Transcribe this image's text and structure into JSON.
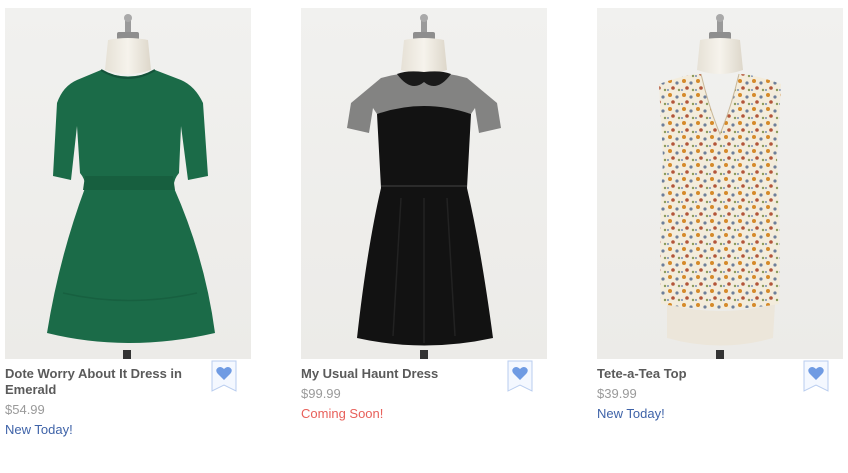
{
  "products": [
    {
      "title": "Dote Worry About It Dress in Emerald",
      "price": "$54.99",
      "badge": "New Today!",
      "badge_type": "new",
      "garment_color": "#1b6b48",
      "image": "emerald-dress-on-mannequin",
      "favorite_icon": "heart-icon"
    },
    {
      "title": "My Usual Haunt Dress",
      "price": "$99.99",
      "badge": "Coming Soon!",
      "badge_type": "soon",
      "garment_color": "#121212",
      "image": "black-velvet-dress-on-mannequin",
      "favorite_icon": "heart-icon"
    },
    {
      "title": "Tete-a-Tea Top",
      "price": "$39.99",
      "badge": "New Today!",
      "badge_type": "new",
      "garment_color": "#efe6d2",
      "image": "floral-top-on-mannequin",
      "favorite_icon": "heart-icon"
    }
  ],
  "colors": {
    "title": "#5a5a5a",
    "price": "#9a9a9a",
    "new_badge": "#3f63a8",
    "soon_badge": "#e8605a",
    "favorite_heart": "#6f9be3"
  }
}
